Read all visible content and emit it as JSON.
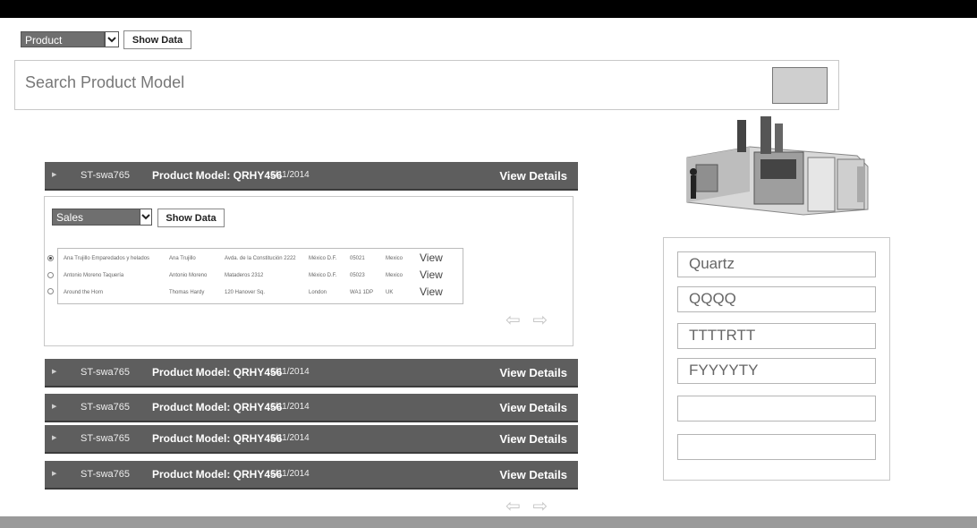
{
  "top_controls": {
    "dropdown_value": "Product",
    "show_data_label": "Show Data"
  },
  "search": {
    "placeholder": "Search Product Model"
  },
  "rows": [
    {
      "code": "ST-swa765",
      "model": "Product Model: QRHY456",
      "date": "6/11/2014",
      "action": "View Details"
    },
    {
      "code": "ST-swa765",
      "model": "Product Model: QRHY456",
      "date": "6/11/2014",
      "action": "View Details"
    },
    {
      "code": "ST-swa765",
      "model": "Product Model: QRHY456",
      "date": "6/11/2014",
      "action": "View Details"
    },
    {
      "code": "ST-swa765",
      "model": "Product Model: QRHY456",
      "date": "6/11/2014",
      "action": "View Details"
    },
    {
      "code": "ST-swa765",
      "model": "Product Model: QRHY456",
      "date": "6/11/2014",
      "action": "View Details"
    }
  ],
  "detail_panel": {
    "dropdown_value": "Sales",
    "show_data_label": "Show Data",
    "table": [
      {
        "selected": true,
        "company": "Ana Trujillo Emparedados y helados",
        "contact": "Ana Trujillo",
        "address": "Avda. de la Constitución 2222",
        "city": "México D.F.",
        "postal": "05021",
        "country": "Mexico",
        "action": "View"
      },
      {
        "selected": false,
        "company": "Antonio Moreno Taquería",
        "contact": "Antonio Moreno",
        "address": "Mataderos 2312",
        "city": "México D.F.",
        "postal": "05023",
        "country": "Mexico",
        "action": "View"
      },
      {
        "selected": false,
        "company": "Around the Horn",
        "contact": "Thomas Hardy",
        "address": "120 Hanover Sq.",
        "city": "London",
        "postal": "WA1 1DP",
        "country": "UK",
        "action": "View"
      }
    ],
    "pager": "⇦ ⇨"
  },
  "bottom_pager": "⇦ ⇨",
  "machine_image": {
    "icon": "industrial-machine-image"
  },
  "side_fields": [
    "Quartz",
    "QQQQ",
    "TTTTRTT",
    "FYYYYTY",
    "",
    ""
  ]
}
